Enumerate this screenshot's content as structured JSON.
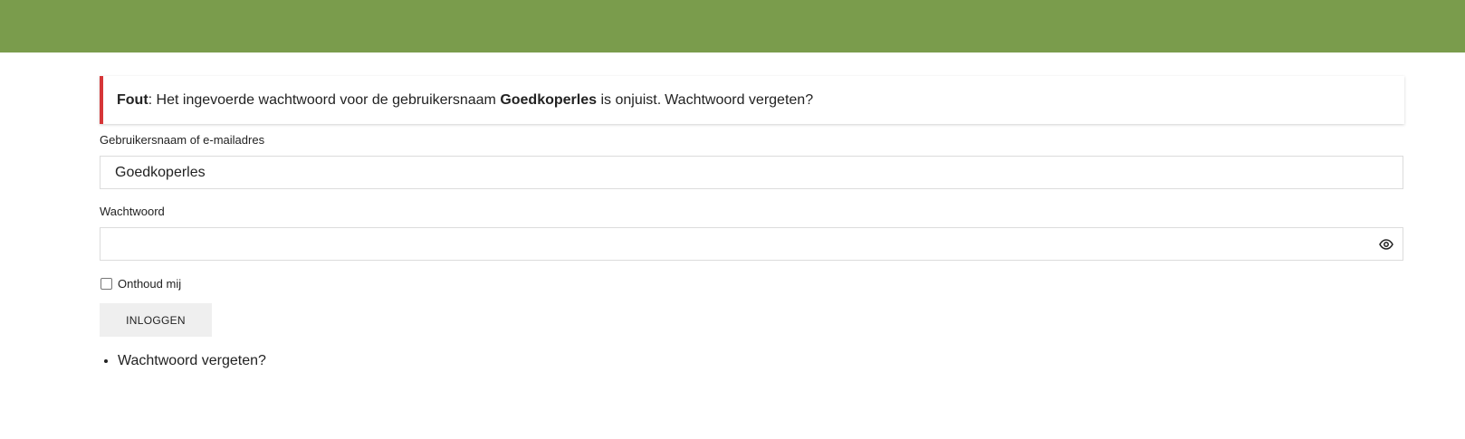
{
  "colors": {
    "header_bar": "#7a9c4c",
    "error_accent": "#d63638"
  },
  "error": {
    "prefix": "Fout",
    "message_part1": ": Het ingevoerde wachtwoord voor de gebruikersnaam ",
    "username": "Goedkoperles",
    "message_part2": " is onjuist.",
    "forgot_link": "Wachtwoord vergeten?"
  },
  "form": {
    "username_label": "Gebruikersnaam of e-mailadres",
    "username_value": "Goedkoperles",
    "password_label": "Wachtwoord",
    "password_value": "",
    "show_password_icon": "eye-icon",
    "remember_label": "Onthoud mij",
    "remember_checked": false,
    "login_label": "INLOGGEN"
  },
  "links": {
    "forgot_password": "Wachtwoord vergeten?"
  }
}
